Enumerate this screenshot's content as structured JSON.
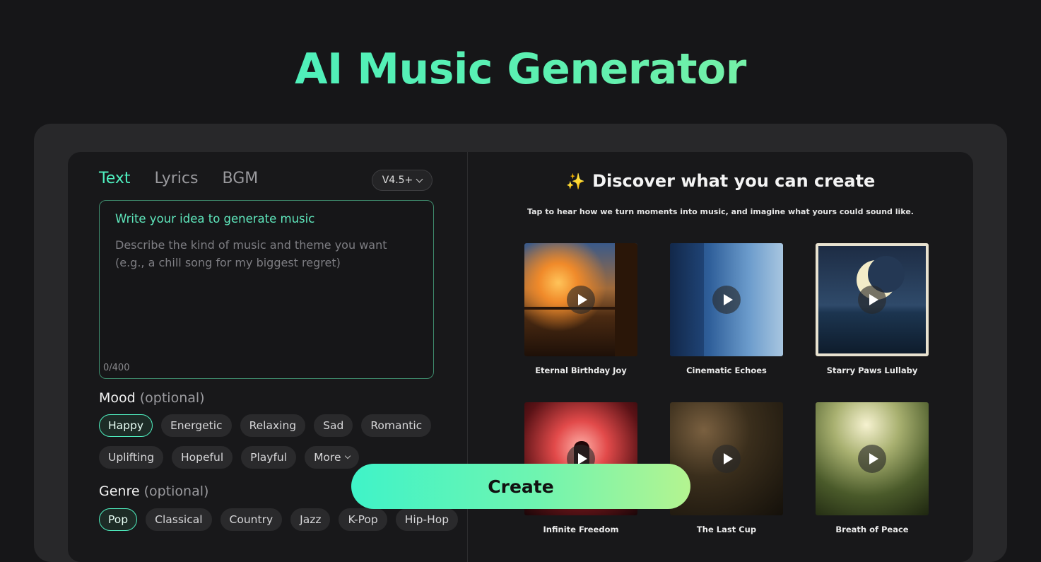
{
  "page": {
    "title": "AI Music Generator"
  },
  "tabs": [
    "Text",
    "Lyrics",
    "BGM"
  ],
  "version": {
    "label": "V4.5+"
  },
  "prompt": {
    "heading": "Write your idea to generate music",
    "placeholder": "Describe the kind of music and theme you want\n(e.g., a chill song for my biggest regret)",
    "value": "",
    "char_count": "0/400"
  },
  "mood": {
    "label": "Mood",
    "optional": "(optional)",
    "options": [
      "Happy",
      "Energetic",
      "Relaxing",
      "Sad",
      "Romantic",
      "Uplifting",
      "Hopeful",
      "Playful",
      "More"
    ],
    "selected": "Happy"
  },
  "genre": {
    "label": "Genre",
    "optional": "(optional)",
    "options": [
      "Pop",
      "Classical",
      "Country",
      "Jazz",
      "K-Pop",
      "Hip-Hop"
    ],
    "selected": "Pop"
  },
  "discover": {
    "title": "Discover what you can create",
    "subtitle": "Tap to hear how we turn moments into music, and imagine what yours could sound like.",
    "cards": [
      {
        "title": "Eternal Birthday Joy"
      },
      {
        "title": "Cinematic Echoes"
      },
      {
        "title": "Starry Paws Lullaby"
      },
      {
        "title": "Infinite Freedom"
      },
      {
        "title": "The Last Cup"
      },
      {
        "title": "Breath of Peace"
      }
    ]
  },
  "actions": {
    "create_label": "Create"
  },
  "colors": {
    "accent": "#4ff0c0",
    "background": "#161618",
    "panel": "#18181a"
  }
}
